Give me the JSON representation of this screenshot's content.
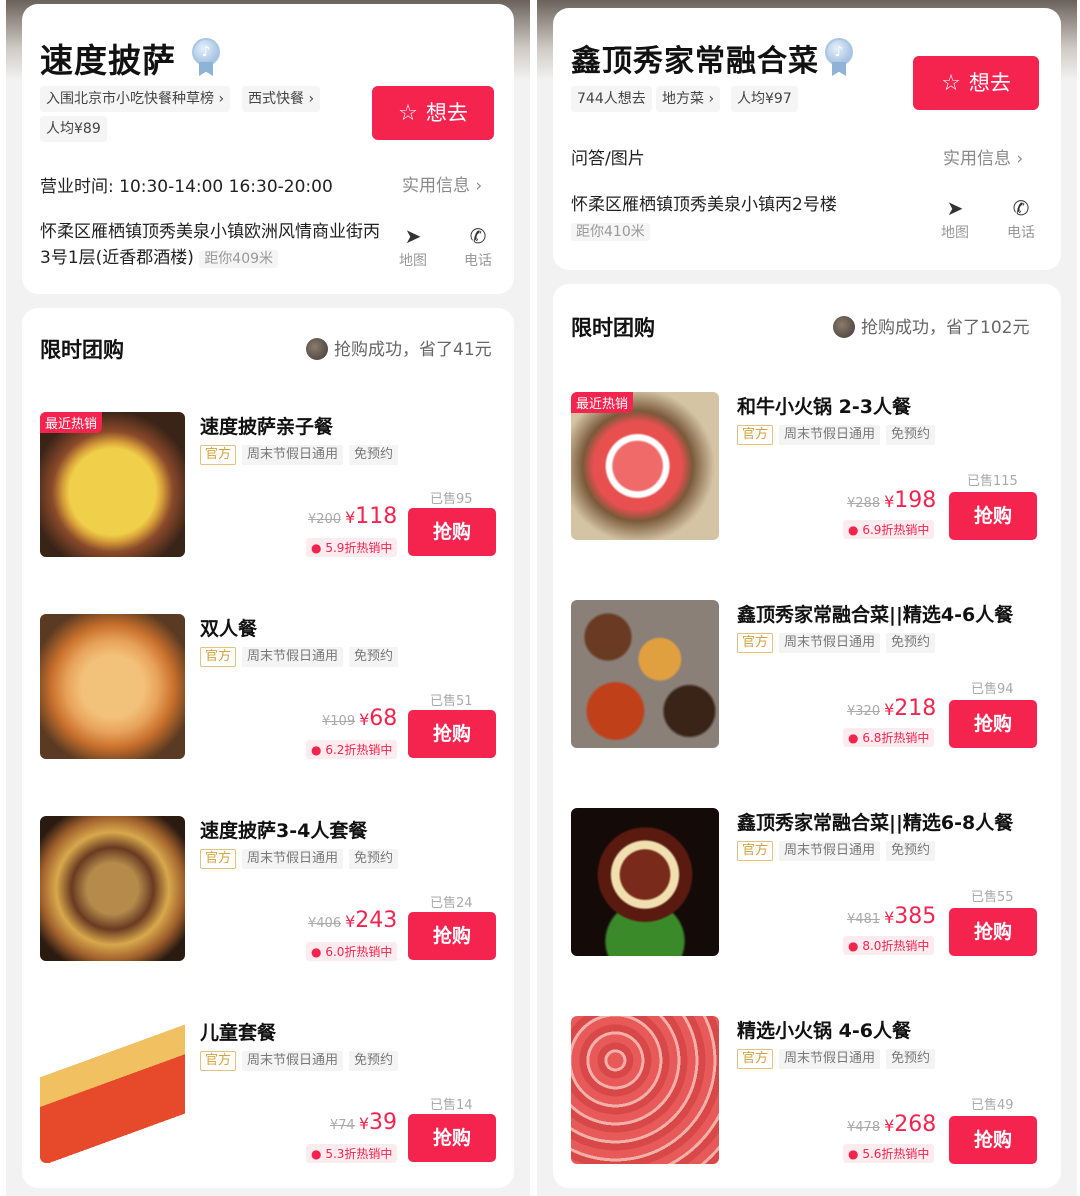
{
  "left": {
    "shop_name": "速度披萨",
    "tags": [
      "入围北京市小吃快餐种草榜 ›",
      "西式快餐 ›",
      "人均¥89"
    ],
    "want_button": "想去",
    "hours": "营业时间: 10:30-14:00 16:30-20:00",
    "info_link": "实用信息 ›",
    "address": "怀柔区雁栖镇顶秀美泉小镇欧洲风情商业街丙3号1层(近香郡酒楼)",
    "distance": "距你409米",
    "map_label": "地图",
    "phone_label": "电话",
    "section_title": "限时团购",
    "purchase_note": "抢购成功，省了41元",
    "deals": [
      {
        "title": "速度披萨亲子餐",
        "hot": "最近热销",
        "official": "官方",
        "tag1": "周末节假日通用",
        "tag2": "免预约",
        "sold": "已售95",
        "orig": "¥200",
        "price": "118",
        "discount": "5.9折热销中",
        "buy": "抢购"
      },
      {
        "title": "双人餐",
        "hot": "",
        "official": "官方",
        "tag1": "周末节假日通用",
        "tag2": "免预约",
        "sold": "已售51",
        "orig": "¥109",
        "price": "68",
        "discount": "6.2折热销中",
        "buy": "抢购"
      },
      {
        "title": "速度披萨3-4人套餐",
        "hot": "",
        "official": "官方",
        "tag1": "周末节假日通用",
        "tag2": "免预约",
        "sold": "已售24",
        "orig": "¥406",
        "price": "243",
        "discount": "6.0折热销中",
        "buy": "抢购"
      },
      {
        "title": "儿童套餐",
        "hot": "",
        "official": "官方",
        "tag1": "周末节假日通用",
        "tag2": "免预约",
        "sold": "已售14",
        "orig": "¥74",
        "price": "39",
        "discount": "5.3折热销中",
        "buy": "抢购"
      }
    ]
  },
  "right": {
    "shop_name": "鑫顶秀家常融合菜",
    "tags": [
      "744人想去",
      "地方菜 ›",
      "人均¥97"
    ],
    "want_button": "想去",
    "qa_label": "问答/图片",
    "info_link": "实用信息 ›",
    "address": "怀柔区雁栖镇顶秀美泉小镇丙2号楼",
    "distance": "距你410米",
    "map_label": "地图",
    "phone_label": "电话",
    "section_title": "限时团购",
    "purchase_note": "抢购成功，省了102元",
    "deals": [
      {
        "title": "和牛小火锅 2-3人餐",
        "hot": "最近热销",
        "official": "官方",
        "tag1": "周末节假日通用",
        "tag2": "免预约",
        "sold": "已售115",
        "orig": "¥288",
        "price": "198",
        "discount": "6.9折热销中",
        "buy": "抢购"
      },
      {
        "title": "鑫顶秀家常融合菜||精选4-6人餐",
        "hot": "",
        "official": "官方",
        "tag1": "周末节假日通用",
        "tag2": "免预约",
        "sold": "已售94",
        "orig": "¥320",
        "price": "218",
        "discount": "6.8折热销中",
        "buy": "抢购"
      },
      {
        "title": "鑫顶秀家常融合菜||精选6-8人餐",
        "hot": "",
        "official": "官方",
        "tag1": "周末节假日通用",
        "tag2": "免预约",
        "sold": "已售55",
        "orig": "¥481",
        "price": "385",
        "discount": "8.0折热销中",
        "buy": "抢购"
      },
      {
        "title": "精选小火锅 4-6人餐",
        "hot": "",
        "official": "官方",
        "tag1": "周末节假日通用",
        "tag2": "免预约",
        "sold": "已售49",
        "orig": "¥478",
        "price": "268",
        "discount": "5.6折热销中",
        "buy": "抢购"
      }
    ]
  },
  "icons": {
    "star": "star-icon",
    "map": "navigation-arrow-icon",
    "phone": "phone-icon",
    "chevron": "chevron-right-icon",
    "medal": "verified-medal-icon",
    "fire": "fire-icon"
  },
  "colors": {
    "accent": "#f4244f",
    "official": "#d4a23a",
    "background": "#f2f2f2"
  },
  "currency": "¥"
}
